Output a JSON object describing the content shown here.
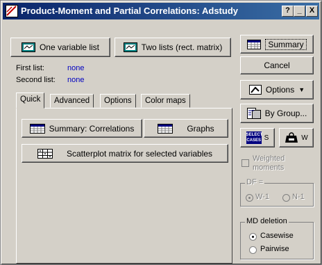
{
  "window": {
    "title": "Product-Moment and Partial Correlations: Adstudy",
    "help_button": "?",
    "minimize_button": "_",
    "close_button": "X"
  },
  "variables": {
    "one_list_label": "One variable list",
    "two_lists_label": "Two lists (rect. matrix)",
    "first_list_label": "First list:",
    "first_list_value": "none",
    "second_list_label": "Second list:",
    "second_list_value": "none"
  },
  "tabs": [
    {
      "label": "Quick",
      "active": true
    },
    {
      "label": "Advanced",
      "active": false
    },
    {
      "label": "Options",
      "active": false
    },
    {
      "label": "Color maps",
      "active": false
    }
  ],
  "quick": {
    "summary_correlations_label": "Summary: Correlations",
    "graphs_label": "Graphs",
    "scatterplot_label": "Scatterplot matrix for selected variables"
  },
  "right_panel": {
    "summary_label": "Summary",
    "cancel_label": "Cancel",
    "options_label": "Options",
    "by_group_label": "By Group...",
    "select_cases_icon_text": "SELECT CASES",
    "select_cases_suffix": "S",
    "weight_suffix": "W",
    "weighted_moments_label": "Weighted moments",
    "df_label": "DF =",
    "df_options": [
      "W-1",
      "N-1"
    ],
    "df_selected": "W-1",
    "md_deletion_label": "MD deletion",
    "md_options": [
      "Casewise",
      "Pairwise"
    ],
    "md_selected": "Casewise"
  },
  "colors": {
    "titlebar_start": "#0a246a",
    "titlebar_end": "#3a6ea5",
    "value_blue": "#0000c0",
    "face": "#d4d0c8"
  }
}
